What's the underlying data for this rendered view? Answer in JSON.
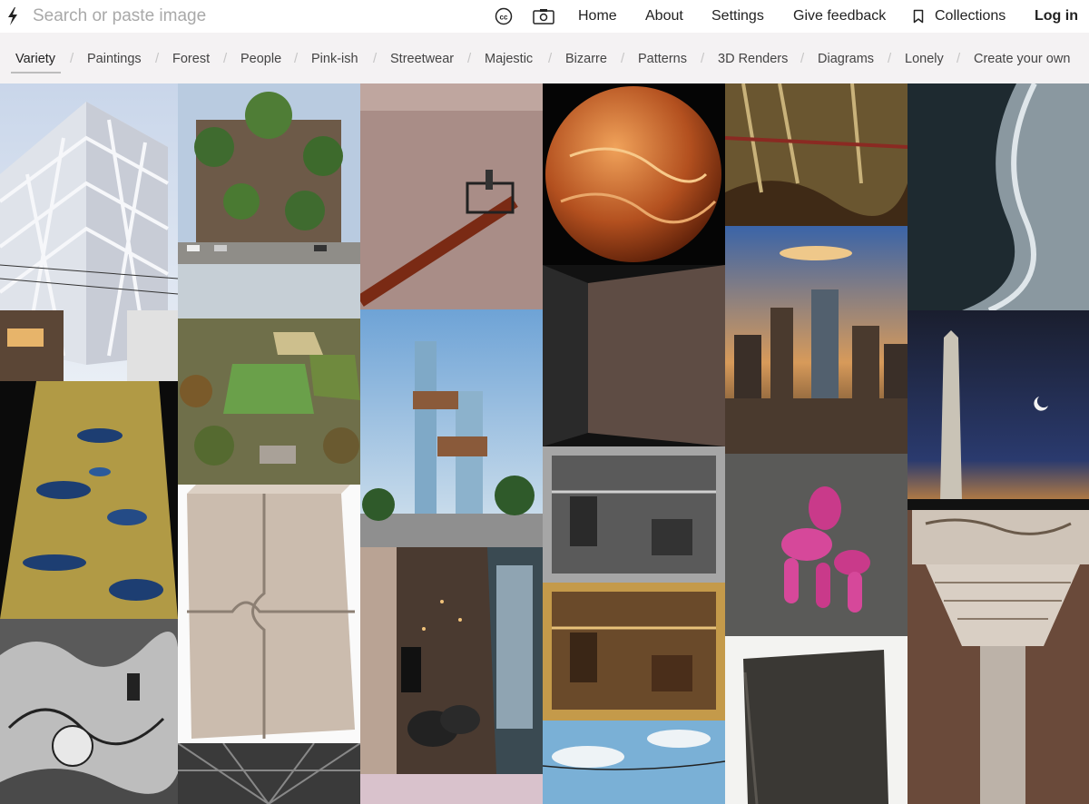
{
  "search": {
    "placeholder": "Search or paste image",
    "value": ""
  },
  "header": {
    "icons": [
      "lightning-logo-icon",
      "cc-icon",
      "camera-icon",
      "bookmark-icon"
    ],
    "nav": {
      "home": "Home",
      "about": "About",
      "settings": "Settings",
      "feedback": "Give feedback",
      "collections": "Collections",
      "login": "Log in"
    }
  },
  "categories": {
    "active": "Variety",
    "items": [
      "Variety",
      "Paintings",
      "Forest",
      "People",
      "Pink-ish",
      "Streetwear",
      "Majestic",
      "Bizarre",
      "Patterns",
      "3D Renders",
      "Diagrams",
      "Lonely",
      "Create your own"
    ],
    "separator": "/"
  },
  "tiles": [
    {
      "subject": "white lattice building"
    },
    {
      "subject": "vertical forest tower"
    },
    {
      "subject": "pink wall with crane lift"
    },
    {
      "subject": "planet venus"
    },
    {
      "subject": "abstract painting"
    },
    {
      "subject": "ocean waves"
    },
    {
      "subject": "aerial park view"
    },
    {
      "subject": "glass skyscraper render"
    },
    {
      "subject": "dark textured wall"
    },
    {
      "subject": "city skyline sunset"
    },
    {
      "subject": "washington monument"
    },
    {
      "subject": "gold and blue texture"
    },
    {
      "subject": "stone puzzle blocks"
    },
    {
      "subject": "black and white dollhouse"
    },
    {
      "subject": "pink balloon dog"
    },
    {
      "subject": "loft interior"
    },
    {
      "subject": "colored dollhouse"
    },
    {
      "subject": "carved column capital"
    },
    {
      "subject": "ink drawing"
    },
    {
      "subject": "leather book"
    },
    {
      "subject": "sky with power lines"
    },
    {
      "subject": "steel structure"
    }
  ],
  "colors": {
    "accent_bg": "#f4f2f3",
    "placeholder": "#a9a9a9"
  }
}
